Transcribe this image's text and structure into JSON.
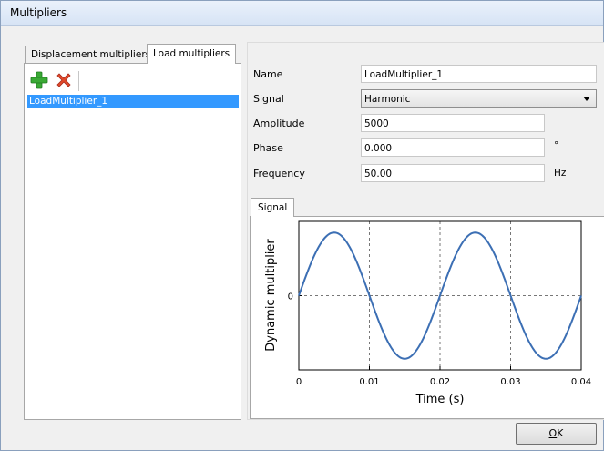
{
  "window": {
    "title": "Multipliers"
  },
  "tabs": [
    {
      "label": "Displacement multipliers"
    },
    {
      "label": "Load multipliers"
    }
  ],
  "toolbar": {
    "add_icon": "plus-icon",
    "delete_icon": "x-icon"
  },
  "list": {
    "items": [
      "LoadMultiplier_1"
    ]
  },
  "form": {
    "name_label": "Name",
    "name_value": "LoadMultiplier_1",
    "signal_label": "Signal",
    "signal_value": "Harmonic",
    "amplitude_label": "Amplitude",
    "amplitude_value": "5000",
    "phase_label": "Phase",
    "phase_value": "0.000",
    "phase_unit": "°",
    "frequency_label": "Frequency",
    "frequency_value": "50.00",
    "frequency_unit": "Hz"
  },
  "signal_tab": {
    "label": "Signal"
  },
  "chart_data": {
    "type": "line",
    "xlabel": "Time (s)",
    "ylabel": "Dynamic multiplier",
    "xlim": [
      0,
      0.04
    ],
    "ylim": [
      -1,
      1
    ],
    "xticks": [
      "0",
      "0.01",
      "0.02",
      "0.03",
      "0.04"
    ],
    "yticks": [
      "0"
    ],
    "grid": "dashed",
    "function": "sin",
    "frequency_hz": 50,
    "color": "#3c6fb4"
  },
  "buttons": {
    "ok_label": "OK",
    "ok_mnemonic": "O",
    "ok_rest": "K"
  }
}
